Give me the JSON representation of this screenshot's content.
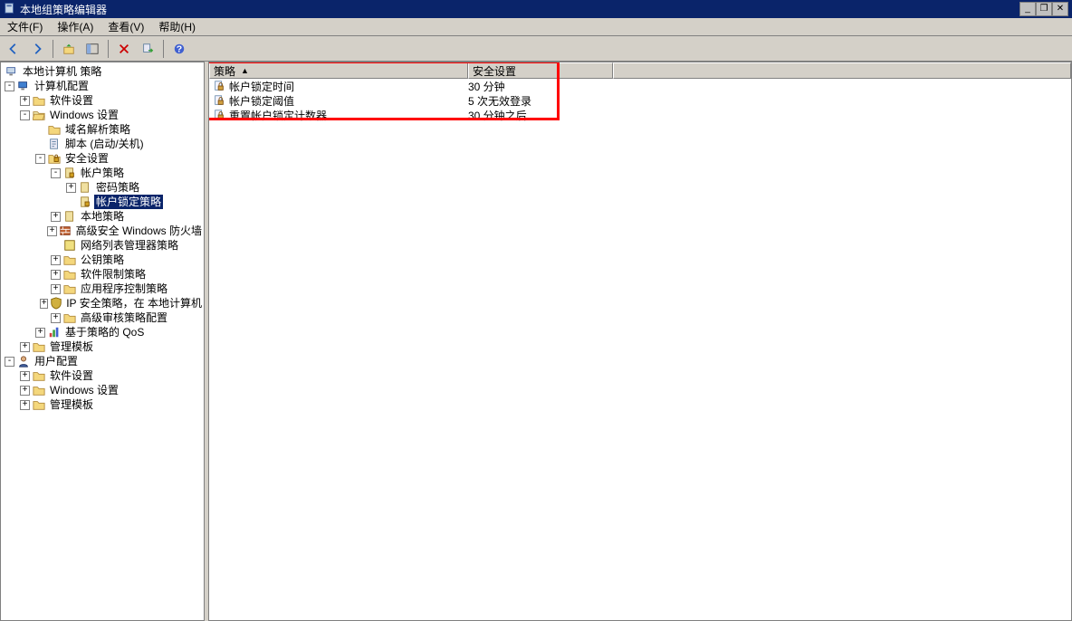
{
  "window": {
    "title": "本地组策略编辑器"
  },
  "menu": {
    "file": "文件(F)",
    "action": "操作(A)",
    "view": "查看(V)",
    "help": "帮助(H)"
  },
  "toolbar": {
    "back": "back-icon",
    "forward": "forward-icon",
    "up": "up-icon",
    "show": "show-icon",
    "delete": "delete-icon",
    "refresh": "refresh-icon",
    "export": "export-icon",
    "help": "help-icon"
  },
  "tree": {
    "root": "本地计算机 策略",
    "computer_cfg": "计算机配置",
    "software_settings": "软件设置",
    "windows_settings": "Windows 设置",
    "dns_policy": "域名解析策略",
    "scripts": "脚本 (启动/关机)",
    "security_settings": "安全设置",
    "account_policy": "帐户策略",
    "password_policy": "密码策略",
    "lockout_policy": "帐户锁定策略",
    "local_policies": "本地策略",
    "wfas": "高级安全 Windows 防火墙",
    "nlm_policy": "网络列表管理器策略",
    "pk_policy": "公钥策略",
    "srp": "软件限制策略",
    "acp": "应用程序控制策略",
    "ipsec": "IP 安全策略，在 本地计算机",
    "aap": "高级审核策略配置",
    "qos": "基于策略的 QoS",
    "admin_templates": "管理模板",
    "user_cfg": "用户配置",
    "u_software": "软件设置",
    "u_windows": "Windows 设置",
    "u_admin": "管理模板"
  },
  "list": {
    "col_policy": "策略",
    "col_setting": "安全设置",
    "rows": [
      {
        "policy": "帐户锁定时间",
        "setting": "30 分钟"
      },
      {
        "policy": "帐户锁定阈值",
        "setting": "5 次无效登录"
      },
      {
        "policy": "重置帐户锁定计数器",
        "setting": "30 分钟之后"
      }
    ]
  },
  "watermark": ""
}
